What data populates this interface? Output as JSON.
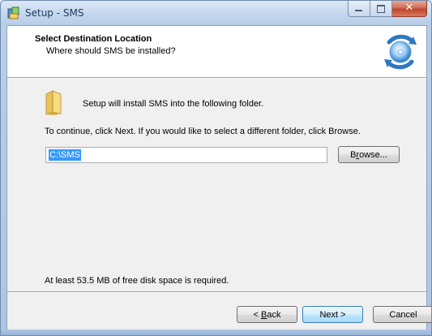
{
  "window": {
    "title": "Setup - SMS",
    "close_glyph": "✕"
  },
  "header": {
    "title": "Select Destination Location",
    "subtitle": "Where should SMS be installed?"
  },
  "body": {
    "install_message": "Setup will install SMS into the following folder.",
    "continue_message": "To continue, click Next. If you would like to select a different folder, click Browse.",
    "path_value": "C:\\SMS",
    "browse_label_pre": "B",
    "browse_label_mnemonic": "r",
    "browse_label_post": "owse...",
    "disk_space_message": "At least 53.5 MB of free disk space is required."
  },
  "footer": {
    "back_prefix": "< ",
    "back_mnemonic": "B",
    "back_suffix": "ack",
    "next_label": "Next >",
    "cancel_label": "Cancel"
  },
  "icons": {
    "app": "setup-app-icon",
    "wizard": "install-disc-icon",
    "folder": "folder-icon"
  },
  "colors": {
    "selection": "#3399ff",
    "default_button_border": "#3c7fb1"
  }
}
